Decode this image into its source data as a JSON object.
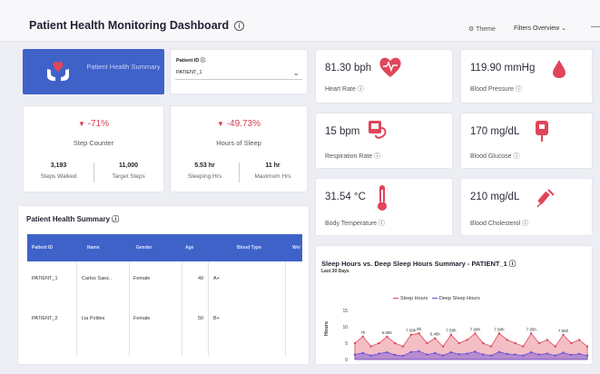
{
  "header": {
    "title": "Patient Health Monitoring Dashboard",
    "theme_label": "Theme",
    "filters_label": "Filters Overview"
  },
  "hero": {
    "label": "Patient Health Summary"
  },
  "patient_filter": {
    "label": "Patient ID",
    "value": "PATIENT_1"
  },
  "kpis": [
    {
      "change": "-71%",
      "name": "Step Counter",
      "stat1_value": "3,193",
      "stat1_label": "Steps Walked",
      "stat2_value": "11,000",
      "stat2_label": "Target Steps"
    },
    {
      "change": "-49.73%",
      "name": "Hours of Sleep",
      "stat1_value": "5.53 hr",
      "stat1_label": "Sleeping Hrs",
      "stat2_value": "11 hr",
      "stat2_label": "Maximum Hrs"
    }
  ],
  "vitals": [
    {
      "value": "81.30 bph",
      "label": "Heart Rate",
      "icon": "heart-pulse-icon",
      "color": "#e0455a"
    },
    {
      "value": "119.90 mmHg",
      "label": "Blood Pressure",
      "icon": "blood-drop-icon",
      "color": "#e0455a"
    },
    {
      "value": "15 bpm",
      "label": "Respiration Rate",
      "icon": "respiration-monitor-icon",
      "color": "#e0455a"
    },
    {
      "value": "170 mg/dL",
      "label": "Blood Glucose",
      "icon": "blood-bag-icon",
      "color": "#e0455a"
    },
    {
      "value": "31.54 °C",
      "label": "Body Temperature",
      "icon": "thermometer-icon",
      "color": "#e0455a"
    },
    {
      "value": "210 mg/dL",
      "label": "Blood Cholesterol",
      "icon": "syringe-icon",
      "color": "#e0455a"
    }
  ],
  "summary": {
    "title": "Patient Health Summary",
    "columns": [
      "Patient ID",
      "Name",
      "Gender",
      "Age",
      "Blood Type",
      "Wei"
    ],
    "rows": [
      [
        "PATIENT_1",
        "Carlos Saez..",
        "Female",
        "49",
        "A+"
      ],
      [
        "PATIENT_2",
        "Lia Poitles",
        "Female",
        "50",
        "B+"
      ]
    ]
  },
  "sleep_chart": {
    "title": "Sleep Hours vs. Deep Sleep Hours Summary - PATIENT_1",
    "subtitle": "Last 30 Days",
    "legend": [
      "Sleep Hours",
      "Deep Sleep Hours"
    ],
    "y_label": "Hours",
    "y_ticks": [
      "15",
      "10",
      "5",
      "0"
    ],
    "point_labels": [
      "7h",
      "6.96h",
      "7.58h",
      "8h",
      "6.46h",
      "7.58h",
      "7.98h",
      "7.98h",
      "7.95h",
      "7.55h"
    ]
  },
  "chart_data": {
    "type": "area",
    "title": "Sleep Hours vs. Deep Sleep Hours Summary - PATIENT_1",
    "subtitle": "Last 30 Days",
    "ylabel": "Hours",
    "ylim": [
      0,
      15
    ],
    "series": [
      {
        "name": "Sleep Hours",
        "color": "#e0455a",
        "values": [
          5,
          7,
          4,
          5,
          6.96,
          5,
          4,
          7.58,
          8,
          5,
          6.46,
          4,
          7.58,
          5,
          6,
          7.98,
          5,
          4,
          7.98,
          6,
          5,
          4,
          7.95,
          5,
          6,
          4,
          7.55,
          5,
          6,
          4
        ]
      },
      {
        "name": "Deep Sleep Hours",
        "color": "#6b4fd8",
        "values": [
          1.5,
          2,
          1.2,
          1.8,
          2.2,
          1.4,
          1.1,
          2.3,
          2.5,
          1.5,
          2,
          1.2,
          2.2,
          1.6,
          1.8,
          2.4,
          1.5,
          1.2,
          2.3,
          1.7,
          1.5,
          1.2,
          2.2,
          1.5,
          1.8,
          1.2,
          2.1,
          1.4,
          1.7,
          1.2
        ]
      }
    ]
  }
}
